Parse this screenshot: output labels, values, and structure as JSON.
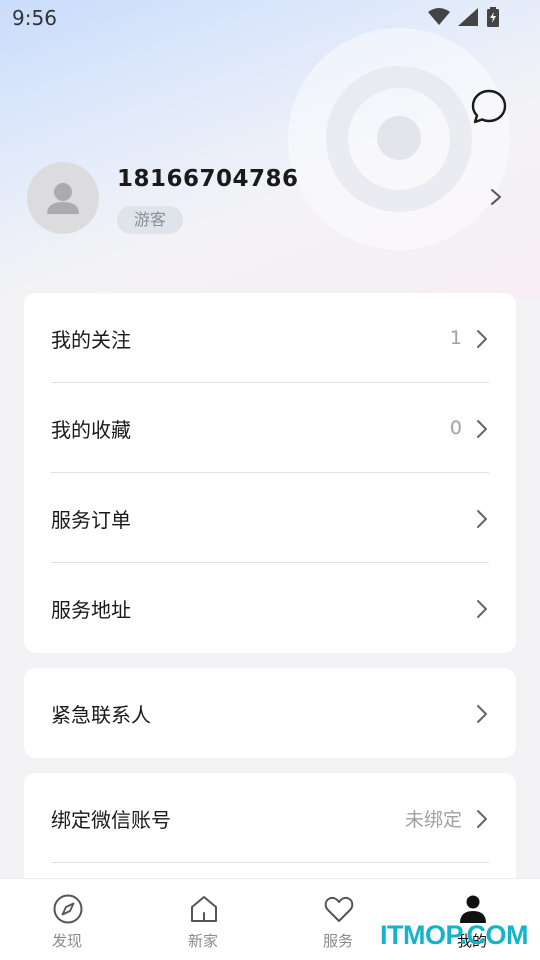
{
  "status_bar": {
    "time": "9:56"
  },
  "profile": {
    "phone": "18166704786",
    "badge": "游客"
  },
  "menu_group_1": [
    {
      "label": "我的关注",
      "value": "1"
    },
    {
      "label": "我的收藏",
      "value": "0"
    },
    {
      "label": "服务订单",
      "value": ""
    },
    {
      "label": "服务地址",
      "value": ""
    }
  ],
  "menu_group_2": [
    {
      "label": "紧急联系人",
      "value": ""
    }
  ],
  "menu_group_3": [
    {
      "label": "绑定微信账号",
      "value": "未绑定"
    }
  ],
  "bottom_nav": [
    {
      "label": "发现",
      "icon": "compass-icon"
    },
    {
      "label": "新家",
      "icon": "home-icon"
    },
    {
      "label": "服务",
      "icon": "heart-icon"
    },
    {
      "label": "我的",
      "icon": "user-icon",
      "active": true
    }
  ],
  "watermark": "ITMOP.COM",
  "colors": {
    "accent": "#111111",
    "muted": "#8a8a8f",
    "watermark": "#14b3cc"
  }
}
